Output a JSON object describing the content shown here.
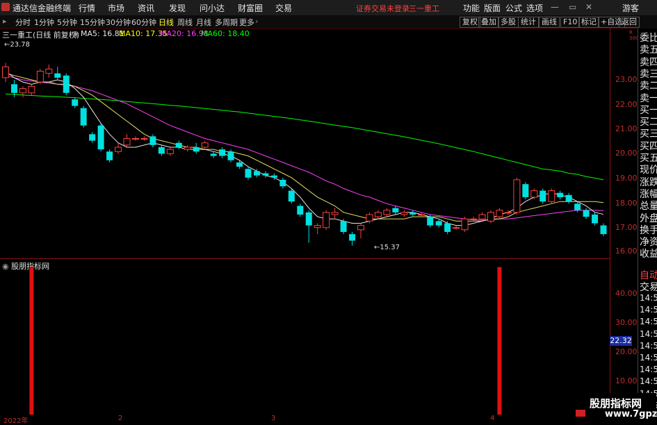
{
  "menubar": {
    "app_title": "通达信金融终端",
    "items": [
      "行情",
      "市场",
      "资讯",
      "发现",
      "问小达",
      "财富圈",
      "交易"
    ],
    "status": "证券交易未登录",
    "stock_name": "三一重工",
    "right_items": [
      "功能",
      "版面",
      "公式",
      "选项"
    ],
    "guest": "游客"
  },
  "toolbar": {
    "periods": [
      "分时",
      "1分钟",
      "5分钟",
      "15分钟",
      "30分钟",
      "60分钟",
      "日线",
      "周线",
      "月线",
      "多周期",
      "更多"
    ],
    "active_period": "日线",
    "right_buttons": [
      "复权",
      "叠加",
      "多股",
      "统计",
      "画线",
      "F10",
      "标记",
      "+自选",
      "返回"
    ]
  },
  "info": {
    "title": "三一重工(日线 前复权)",
    "ma5": "MA5: 16.81",
    "ma10": "MA10: 17.35",
    "ma20": "MA20: 16.98",
    "ma60": "MA60: 18.40",
    "ma5_color": "#ffffff",
    "ma10_color": "#ffff00",
    "ma20_color": "#ff40ff",
    "ma60_color": "#00ff00"
  },
  "annotations": {
    "high": "23.78",
    "low": "15.37"
  },
  "indicator": {
    "name": "股朋指标网"
  },
  "right_axis": {
    "main_ticks": [
      "23.00",
      "22.00",
      "21.00",
      "20.00",
      "19.00",
      "18.00",
      "17.00",
      "16.00"
    ],
    "sub_ticks": [
      "40.00",
      "30.00",
      "20.00",
      "10.00"
    ],
    "current_price": "22.32",
    "corner": "R 300"
  },
  "side_panel": {
    "items": [
      "委比",
      "卖五",
      "卖四",
      "卖三",
      "卖二",
      "卖一",
      "买一",
      "买二",
      "买三",
      "买四",
      "买五",
      "现价",
      "涨跌",
      "涨幅",
      "总量",
      "外盘",
      "换手",
      "净资",
      "收益"
    ],
    "tabs": [
      "自动",
      "交易"
    ],
    "times": [
      "14:56",
      "14:56",
      "14:56",
      "14:56",
      "14:56",
      "14:56",
      "14:56",
      "14:56",
      "14:56",
      "14:56",
      "14:56"
    ]
  },
  "date_axis": [
    "2022年",
    "2",
    "3",
    "4"
  ],
  "watermark": {
    "line1": "股朋指标网",
    "line2": "www.7gpzb.com"
  },
  "chart_data": {
    "type": "candlestick",
    "price_range": [
      15.2,
      24.0
    ],
    "candles": [
      [
        23.1,
        23.6,
        22.9,
        23.78
      ],
      [
        22.8,
        22.4,
        22.2,
        23.0
      ],
      [
        22.4,
        22.6,
        22.2,
        22.7
      ],
      [
        22.4,
        22.7,
        22.3,
        22.8
      ],
      [
        22.9,
        23.4,
        22.8,
        23.5
      ],
      [
        23.3,
        23.5,
        23.1,
        23.7
      ],
      [
        23.3,
        23.1,
        23.0,
        23.6
      ],
      [
        23.2,
        22.4,
        22.3,
        23.3
      ],
      [
        22.1,
        21.8,
        21.7,
        22.2
      ],
      [
        21.7,
        20.9,
        20.8,
        21.8
      ],
      [
        20.5,
        20.2,
        20.1,
        20.6
      ],
      [
        20.9,
        19.8,
        19.7,
        21.0
      ],
      [
        19.7,
        19.3,
        19.2,
        19.8
      ],
      [
        19.7,
        19.9,
        19.6,
        20.1
      ],
      [
        20.0,
        20.3,
        19.9,
        20.5
      ],
      [
        20.3,
        20.3,
        20.2,
        20.4
      ],
      [
        20.3,
        20.3,
        20.2,
        20.4
      ],
      [
        20.4,
        20.0,
        19.9,
        20.5
      ],
      [
        19.9,
        19.6,
        19.5,
        20.0
      ],
      [
        19.6,
        19.8,
        19.5,
        19.9
      ],
      [
        20.1,
        19.9,
        19.8,
        20.2
      ],
      [
        19.8,
        19.9,
        19.7,
        20.0
      ],
      [
        19.9,
        19.7,
        19.6,
        20.1
      ],
      [
        19.9,
        20.1,
        19.8,
        20.2
      ],
      [
        19.6,
        19.5,
        19.4,
        19.7
      ],
      [
        19.8,
        19.5,
        19.4,
        19.9
      ],
      [
        19.7,
        19.3,
        19.2,
        19.8
      ],
      [
        19.2,
        19.0,
        18.9,
        19.3
      ],
      [
        18.9,
        18.5,
        18.4,
        19.0
      ],
      [
        18.8,
        18.6,
        18.5,
        18.9
      ],
      [
        18.7,
        18.6,
        18.5,
        18.8
      ],
      [
        18.6,
        18.5,
        18.4,
        18.7
      ],
      [
        18.4,
        18.1,
        18.0,
        18.5
      ],
      [
        17.9,
        17.4,
        17.3,
        18.0
      ],
      [
        17.2,
        16.8,
        16.7,
        17.3
      ],
      [
        16.9,
        16.3,
        15.5,
        17.0
      ],
      [
        16.2,
        16.3,
        15.9,
        16.4
      ],
      [
        16.2,
        16.9,
        16.1,
        17.0
      ],
      [
        16.8,
        16.9,
        16.6,
        17.1
      ],
      [
        16.5,
        16.0,
        15.9,
        16.6
      ],
      [
        15.9,
        15.6,
        15.37,
        16.0
      ],
      [
        16.1,
        16.3,
        15.7,
        16.4
      ],
      [
        16.5,
        16.8,
        16.4,
        16.9
      ],
      [
        16.7,
        16.9,
        16.6,
        17.0
      ],
      [
        16.8,
        17.0,
        16.7,
        17.1
      ],
      [
        17.1,
        16.9,
        16.8,
        17.2
      ],
      [
        16.8,
        16.9,
        16.7,
        17.0
      ],
      [
        16.9,
        16.8,
        16.7,
        17.0
      ],
      [
        16.8,
        16.8,
        16.7,
        16.9
      ],
      [
        16.7,
        16.3,
        16.2,
        16.8
      ],
      [
        16.5,
        16.3,
        16.2,
        16.6
      ],
      [
        16.4,
        16.0,
        15.9,
        16.5
      ],
      [
        16.2,
        16.2,
        16.1,
        16.3
      ],
      [
        16.1,
        16.6,
        16.0,
        16.7
      ],
      [
        16.6,
        16.6,
        16.5,
        16.7
      ],
      [
        16.6,
        16.8,
        16.5,
        16.9
      ],
      [
        16.5,
        16.9,
        16.4,
        17.0
      ],
      [
        16.7,
        17.0,
        16.6,
        17.1
      ],
      [
        16.9,
        16.9,
        16.8,
        17.0
      ],
      [
        16.9,
        18.4,
        16.8,
        18.5
      ],
      [
        18.2,
        17.6,
        17.5,
        18.3
      ],
      [
        17.6,
        17.9,
        17.5,
        18.0
      ],
      [
        17.9,
        17.4,
        17.3,
        18.0
      ],
      [
        17.4,
        17.9,
        17.3,
        18.0
      ],
      [
        17.8,
        17.6,
        17.5,
        17.9
      ],
      [
        17.7,
        17.4,
        17.3,
        17.8
      ],
      [
        17.3,
        17.0,
        16.9,
        17.4
      ],
      [
        17.0,
        16.7,
        16.6,
        17.1
      ],
      [
        16.8,
        16.4,
        16.3,
        16.9
      ],
      [
        16.3,
        15.9,
        15.8,
        16.4
      ]
    ],
    "ma5": [
      23.4,
      23.1,
      22.9,
      22.8,
      22.9,
      22.9,
      23.0,
      22.9,
      22.6,
      22.2,
      21.6,
      21.0,
      20.5,
      20.1,
      19.9,
      19.9,
      20.0,
      20.1,
      20.0,
      19.9,
      19.9,
      19.8,
      19.8,
      19.8,
      19.7,
      19.6,
      19.5,
      19.3,
      19.0,
      18.8,
      18.6,
      18.5,
      18.3,
      18.0,
      17.6,
      17.1,
      16.7,
      16.6,
      16.6,
      16.5,
      16.4,
      16.4,
      16.5,
      16.6,
      16.7,
      16.8,
      16.9,
      16.9,
      16.8,
      16.7,
      16.6,
      16.4,
      16.3,
      16.3,
      16.4,
      16.5,
      16.6,
      16.8,
      16.9,
      17.1,
      17.4,
      17.6,
      17.7,
      17.8,
      17.7,
      17.6,
      17.4,
      17.2,
      16.9,
      16.81
    ],
    "ma10": [
      23.3,
      23.2,
      23.1,
      23.0,
      22.9,
      22.9,
      22.8,
      22.8,
      22.7,
      22.5,
      22.3,
      22.0,
      21.7,
      21.4,
      21.1,
      20.8,
      20.5,
      20.3,
      20.2,
      20.1,
      20.0,
      19.9,
      19.9,
      19.8,
      19.8,
      19.7,
      19.7,
      19.6,
      19.5,
      19.3,
      19.1,
      18.9,
      18.7,
      18.5,
      18.2,
      17.9,
      17.6,
      17.4,
      17.2,
      16.9,
      16.8,
      16.7,
      16.6,
      16.6,
      16.6,
      16.6,
      16.6,
      16.7,
      16.7,
      16.7,
      16.7,
      16.6,
      16.5,
      16.5,
      16.5,
      16.5,
      16.6,
      16.6,
      16.7,
      16.9,
      17.0,
      17.1,
      17.2,
      17.3,
      17.4,
      17.4,
      17.4,
      17.4,
      17.4,
      17.35
    ],
    "ma20": [
      23.2,
      23.1,
      23.0,
      22.95,
      22.9,
      22.85,
      22.8,
      22.75,
      22.7,
      22.6,
      22.5,
      22.35,
      22.2,
      22.05,
      21.9,
      21.7,
      21.5,
      21.3,
      21.1,
      20.9,
      20.75,
      20.6,
      20.45,
      20.3,
      20.2,
      20.1,
      20.0,
      19.9,
      19.8,
      19.65,
      19.5,
      19.35,
      19.2,
      19.05,
      18.9,
      18.75,
      18.55,
      18.35,
      18.2,
      18.0,
      17.85,
      17.7,
      17.6,
      17.45,
      17.3,
      17.2,
      17.1,
      17.0,
      16.9,
      16.8,
      16.75,
      16.7,
      16.65,
      16.6,
      16.55,
      16.55,
      16.55,
      16.6,
      16.6,
      16.65,
      16.7,
      16.75,
      16.8,
      16.85,
      16.9,
      16.95,
      17.0,
      17.0,
      17.0,
      16.98
    ],
    "ma60": [
      22.35,
      22.33,
      22.3,
      22.28,
      22.26,
      22.24,
      22.22,
      22.2,
      22.18,
      22.15,
      22.12,
      22.1,
      22.07,
      22.04,
      22.0,
      21.97,
      21.94,
      21.9,
      21.87,
      21.83,
      21.8,
      21.76,
      21.72,
      21.68,
      21.64,
      21.6,
      21.56,
      21.52,
      21.47,
      21.42,
      21.37,
      21.32,
      21.27,
      21.22,
      21.16,
      21.1,
      21.04,
      20.98,
      20.92,
      20.86,
      20.8,
      20.73,
      20.66,
      20.59,
      20.52,
      20.45,
      20.38,
      20.3,
      20.22,
      20.14,
      20.06,
      19.97,
      19.88,
      19.79,
      19.7,
      19.6,
      19.5,
      19.4,
      19.3,
      19.2,
      19.1,
      19.0,
      18.9,
      18.85,
      18.8,
      18.7,
      18.65,
      18.55,
      18.48,
      18.4
    ],
    "indicator_spikes": [
      {
        "index": 3,
        "value": 48
      },
      {
        "index": 57,
        "value": 48
      }
    ],
    "indicator_range": [
      0,
      50
    ]
  }
}
